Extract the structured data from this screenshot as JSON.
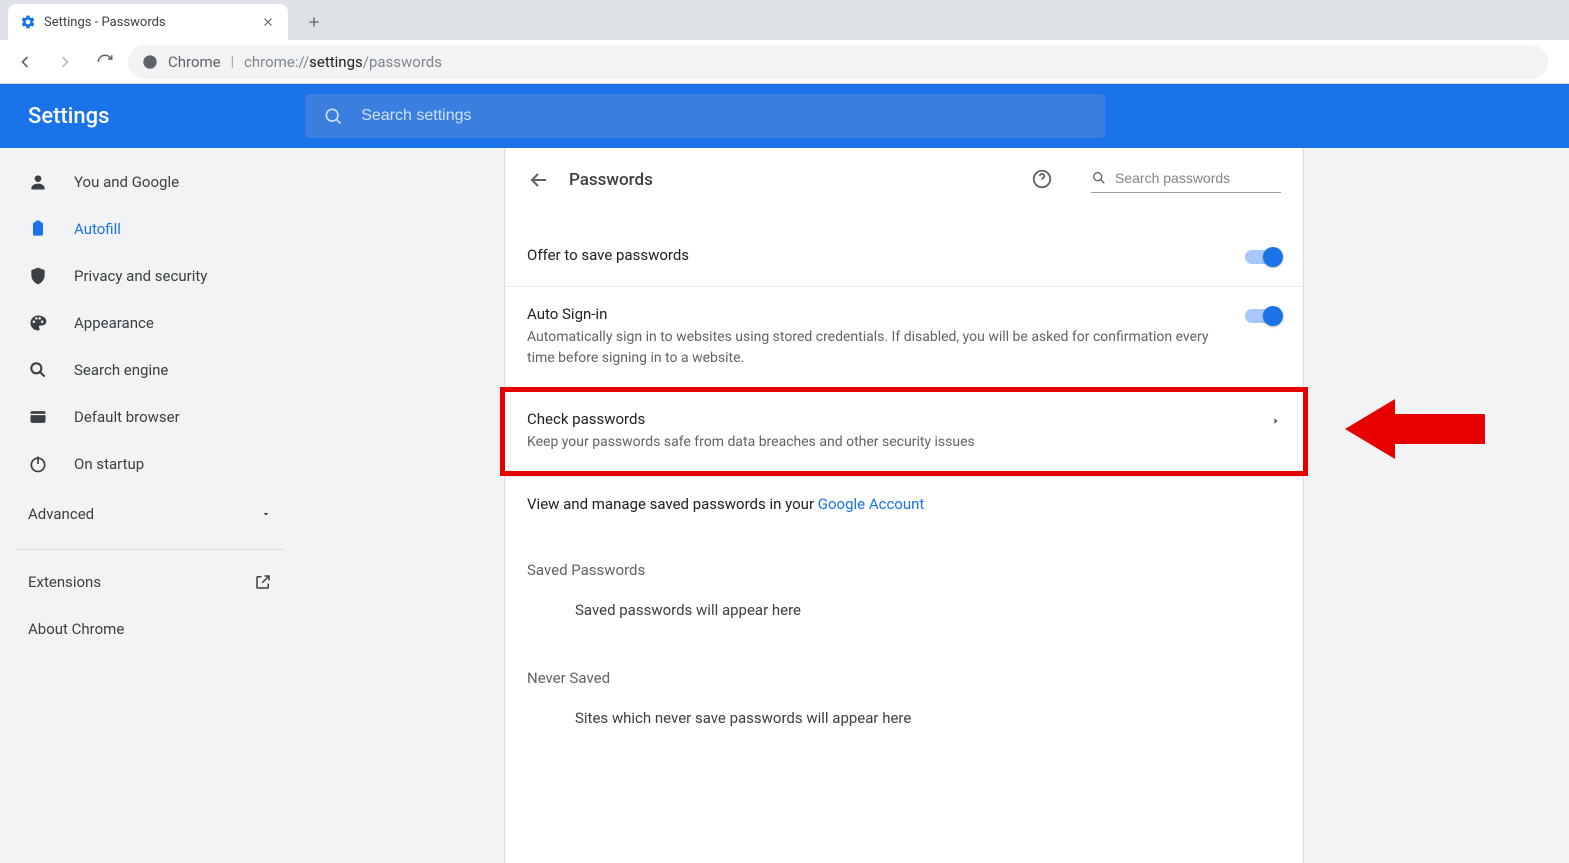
{
  "browser": {
    "tab_title": "Settings - Passwords",
    "omnibox_label": "Chrome",
    "omnibox_url_gray1": "chrome://",
    "omnibox_url_dark": "settings",
    "omnibox_url_gray2": "/passwords"
  },
  "header": {
    "title": "Settings",
    "search_placeholder": "Search settings"
  },
  "sidebar": {
    "items": [
      {
        "icon": "person-icon",
        "label": "You and Google"
      },
      {
        "icon": "clipboard-icon",
        "label": "Autofill",
        "active": true
      },
      {
        "icon": "shield-icon",
        "label": "Privacy and security"
      },
      {
        "icon": "palette-icon",
        "label": "Appearance"
      },
      {
        "icon": "search-icon",
        "label": "Search engine"
      },
      {
        "icon": "browser-icon",
        "label": "Default browser"
      },
      {
        "icon": "power-icon",
        "label": "On startup"
      }
    ],
    "advanced_label": "Advanced",
    "extensions_label": "Extensions",
    "about_label": "About Chrome"
  },
  "panel": {
    "title": "Passwords",
    "search_placeholder": "Search passwords",
    "offer_save": {
      "title": "Offer to save passwords"
    },
    "auto_signin": {
      "title": "Auto Sign-in",
      "sub": "Automatically sign in to websites using stored credentials. If disabled, you will be asked for confirmation every time before signing in to a website."
    },
    "check_passwords": {
      "title": "Check passwords",
      "sub": "Keep your passwords safe from data breaches and other security issues"
    },
    "view_manage_text": "View and manage saved passwords in your ",
    "google_account_link": "Google Account",
    "saved_section": "Saved Passwords",
    "saved_empty": "Saved passwords will appear here",
    "never_section": "Never Saved",
    "never_empty": "Sites which never save passwords will appear here"
  }
}
